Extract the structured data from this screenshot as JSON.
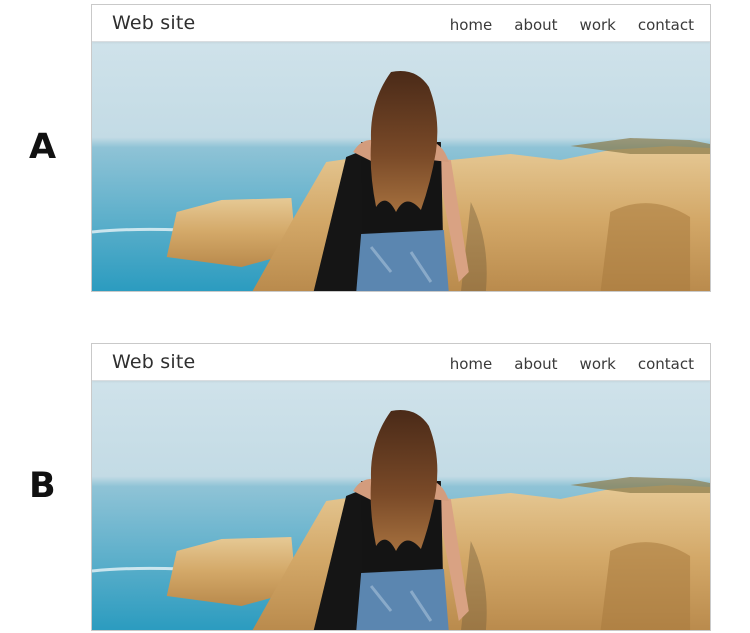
{
  "variants": [
    {
      "label": "A",
      "site_title": "Web site",
      "nav": [
        "home",
        "about",
        "work",
        "contact"
      ]
    },
    {
      "label": "B",
      "site_title": "Web site",
      "nav": [
        "home",
        "about",
        "work",
        "contact"
      ]
    }
  ],
  "hero": {
    "subject": "woman-on-cliff-photo",
    "colors": {
      "sky": "#c9dfe8",
      "sea": "#2f9fc1",
      "cliff": "#d9b47a",
      "hair": "#6b3f22",
      "top": "#141414",
      "jeans": "#5b86b0"
    }
  }
}
